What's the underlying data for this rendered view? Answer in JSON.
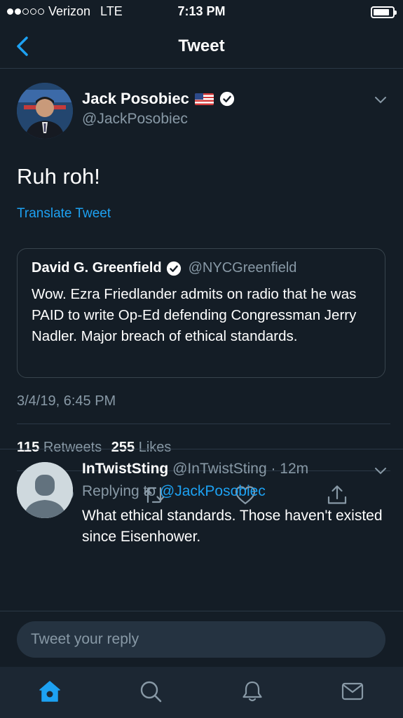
{
  "status_bar": {
    "carrier": "Verizon",
    "network": "LTE",
    "time": "7:13 PM",
    "signal_bars_filled": 2,
    "signal_bars_total": 5,
    "battery_level": 0.85
  },
  "nav": {
    "title": "Tweet",
    "back_icon": "chevron-left-icon"
  },
  "tweet": {
    "author_name": "Jack Posobiec",
    "author_flag": "🇺🇸",
    "author_handle": "@JackPosobiec",
    "verified": true,
    "text": "Ruh roh!",
    "translate_label": "Translate Tweet",
    "timestamp": "3/4/19, 6:45 PM",
    "retweet_count": "115",
    "retweet_label": "Retweets",
    "like_count": "255",
    "like_label": "Likes"
  },
  "quoted_tweet": {
    "author_name": "David G. Greenfield",
    "author_handle": "@NYCGreenfield",
    "verified": true,
    "text": "Wow. Ezra Friedlander admits on radio that he was PAID to write Op-Ed defending Congressman Jerry Nadler. Major breach of ethical standards."
  },
  "actions": [
    "reply-icon",
    "retweet-icon",
    "like-icon",
    "share-icon"
  ],
  "reply": {
    "author_name": "InTwistSting",
    "meta": "@InTwistSting · 12m",
    "replying_prefix": "Replying to",
    "replying_to": "@JackPosobiec",
    "text": "What ethical standards.  Those haven't existed since Eisenhower."
  },
  "composer": {
    "placeholder": "Tweet your reply"
  },
  "tabs": [
    "home-icon",
    "search-icon",
    "notifications-icon",
    "messages-icon"
  ],
  "colors": {
    "background": "#141d26",
    "accent": "#1da1f2",
    "secondary_text": "#8899a6",
    "divider": "#2b3846"
  }
}
